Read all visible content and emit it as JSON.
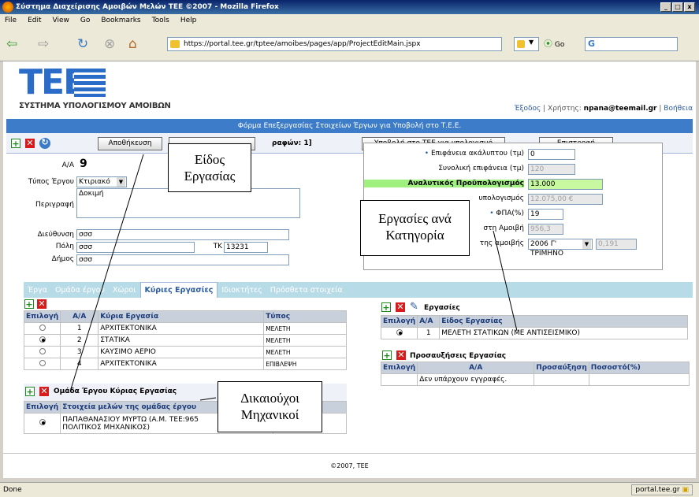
{
  "window": {
    "title": "Σύστημα Διαχείρισης Αμοιβών Μελών ΤΕΕ ©2007 - Mozilla Firefox"
  },
  "menu": [
    "File",
    "Edit",
    "View",
    "Go",
    "Bookmarks",
    "Tools",
    "Help"
  ],
  "nav": {
    "url": "https://portal.tee.gr/tptee/amoibes/pages/app/ProjectEditMain.jspx",
    "go": "Go"
  },
  "header": {
    "logo": "ΤΕΕ",
    "subtitle": "ΣΥΣΤΗΜΑ ΥΠΟΛΟΓΙΣΜΟΥ ΑΜΟΙΒΩΝ",
    "exit": "Έξοδος",
    "user_label": "Χρήστης:",
    "user": "npana@teemail.gr",
    "help": "Βοήθεια"
  },
  "formbar": "Φόρμα Επεξεργασίας Στοιχείων Έργων για Υποβολή στο Τ.Ε.Ε.",
  "toolbar": {
    "save": "Αποθήκευση",
    "partial": "ραφών: 1]",
    "submit": "Υποβολή στο ΤΕΕ για υπολογισμό",
    "back": "Επιστροφή"
  },
  "left": {
    "aa_label": "Α/Α",
    "aa": "9",
    "type_label": "Τύπος Έργου",
    "type": "Κτιριακό",
    "desc_label": "Περιγραφή",
    "desc": "Δοκιμή",
    "addr_label": "Διεύθυνση",
    "addr": "σσσ",
    "city_label": "Πόλη",
    "city": "σσσ",
    "tk_label": "ΤΚ",
    "tk": "13231",
    "municipality_label": "Δήμος",
    "municipality": "σσσ"
  },
  "right": {
    "area_label": "Επιφάνεια ακάλυπτου (τμ)",
    "area": "0",
    "total_label": "Συνολική επιφάνεια (τμ)",
    "total": "120",
    "budget_label": "Αναλυτικός Προϋπολογισμός",
    "budget": "13.000",
    "calc_label": "υπολογισμός",
    "calc": "12.075,00 €",
    "vat_label": "ΦΠΑ(%)",
    "vat": "19",
    "fee_label": "στη Αμοιβή",
    "fee": "956,3",
    "period_label": "της αμοιβής",
    "period": "2006 Γ' ΤΡΙΜΗΝΟ",
    "factor": "0,191"
  },
  "tabs": [
    "Έργα",
    "Ομάδα έργου",
    "Χώροι",
    "Κύριες Εργασίες",
    "Ιδιοκτήτες",
    "Πρόσθετα στοιχεία"
  ],
  "main_table": {
    "headers": [
      "Επιλογή",
      "Α/Α",
      "Κύρια Εργασία",
      "Τύπος"
    ],
    "rows": [
      [
        "1",
        "ΑΡΧΙΤΕΚΤΟΝΙΚΑ",
        "ΜΕΛΕΤΗ"
      ],
      [
        "2",
        "ΣΤΑΤΙΚΑ",
        "ΜΕΛΕΤΗ"
      ],
      [
        "3",
        "ΚΑΥΣΙΜΟ ΑΕΡΙΟ",
        "ΜΕΛΕΤΗ"
      ],
      [
        "4",
        "ΑΡΧΙΤΕΚΤΟΝΙΚΑ",
        "ΕΠΙΒΛΕΨΗ"
      ]
    ]
  },
  "team": {
    "title": "Ομάδα Έργου Κύριας Εργασίας",
    "headers": [
      "Επιλογή",
      "Στοιχεία μελών της ομάδας έργου",
      "ετοχής"
    ],
    "member": "ΠΑΠΑΘΑΝΑΣΙΟΥ ΜΥΡΤΩ (Α.Μ. ΤΕΕ:965",
    "member2": "ΠΟΛΙΤΙΚΟΣ ΜΗΧΑΝΙΚΟΣ)"
  },
  "works": {
    "title": "Εργασίες",
    "headers": [
      "Επιλογή",
      "Α/Α",
      "Είδος Εργασίας"
    ],
    "row": [
      "1",
      "ΜΕΛΕΤΗ ΣΤΑΤΙΚΩΝ (ΜΕ ΑΝΤΙΣΕΙΣΜΙΚΟ)"
    ]
  },
  "surcharges": {
    "title": "Προσαυξήσεις Εργασίας",
    "headers": [
      "Επιλογή",
      "Α/Α",
      "Προσαύξηση",
      "Ποσοστό(%)"
    ],
    "empty": "Δεν υπάρχουν εγγραφές."
  },
  "footer": "©2007, ΤΕΕ",
  "callouts": {
    "c1a": "Είδος",
    "c1b": "Εργασίας",
    "c2a": "Εργασίες ανά",
    "c2b": "Κατηγορία",
    "c3a": "Δικαιούχοι",
    "c3b": "Μηχανικοί"
  },
  "status": {
    "left": "Done",
    "right": "portal.tee.gr"
  }
}
